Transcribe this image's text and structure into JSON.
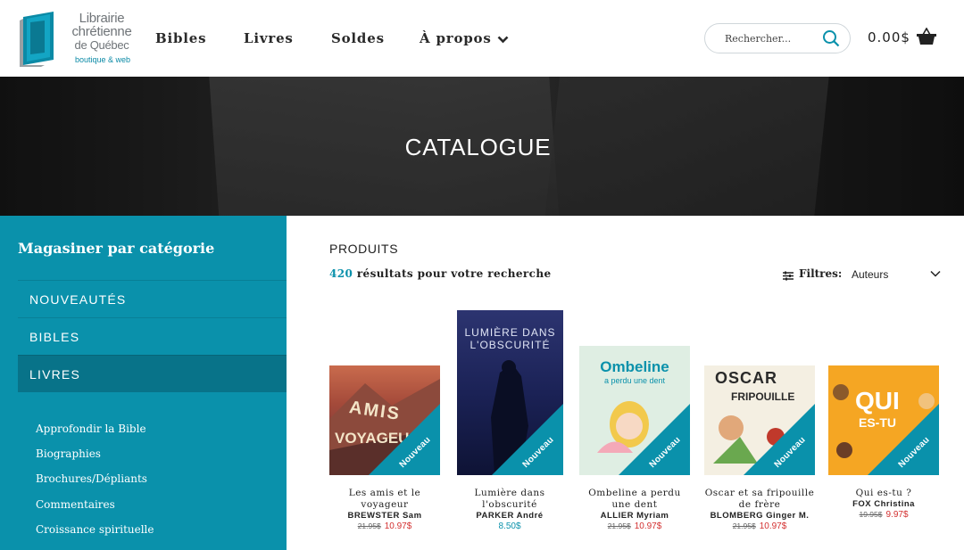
{
  "brand": {
    "line1": "Librairie",
    "line2": "chrétienne",
    "line3": "de Québec",
    "tagline": "boutique & web"
  },
  "nav": {
    "bibles": "Bibles",
    "livres": "Livres",
    "soldes": "Soldes",
    "apropos": "À propos"
  },
  "search": {
    "placeholder": "Rechercher..."
  },
  "cart": {
    "total": "0.00$"
  },
  "hero": {
    "title": "CATALOGUE"
  },
  "sidebar": {
    "title": "Magasiner par catégorie",
    "categories": [
      "NOUVEAUTÉS",
      "BIBLES",
      "LIVRES"
    ],
    "subcategories": [
      "Approfondir la Bible",
      "Biographies",
      "Brochures/Dépliants",
      "Commentaires",
      "Croissance spirituelle"
    ]
  },
  "main": {
    "heading": "PRODUITS",
    "results_count": "420",
    "results_text": " résultats pour votre recherche",
    "filter_label": "Filtres:",
    "filter_value": "Auteurs"
  },
  "ribbon_label": "Nouveau",
  "products": [
    {
      "title": "Les amis et le voyageur",
      "author": "BREWSTER Sam",
      "old_price": "21.95$",
      "price": "10.97$",
      "cover_title": "AMIS VOYAGEUR"
    },
    {
      "title": "Lumière dans l'obscurité",
      "author": "PARKER André",
      "old_price": "",
      "price": "8.50$",
      "cover_title": "LUMIÈRE DANS L'OBSCURITÉ"
    },
    {
      "title": "Ombeline a perdu une dent",
      "author": "ALLIER Myriam",
      "old_price": "21.95$",
      "price": "10.97$",
      "cover_title": "Ombeline"
    },
    {
      "title": "Oscar et sa fripouille de frère",
      "author": "BLOMBERG Ginger M.",
      "old_price": "21.95$",
      "price": "10.97$",
      "cover_title": "OSCAR FRIPOUILLE"
    },
    {
      "title": "Qui es-tu ?",
      "author": "FOX Christina",
      "old_price": "19.95$",
      "price": "9.97$",
      "cover_title": "QUI ES-TU"
    }
  ],
  "colors": {
    "accent": "#0a91ab",
    "sale": "#d32f2f",
    "dark": "#1d1d1d"
  }
}
